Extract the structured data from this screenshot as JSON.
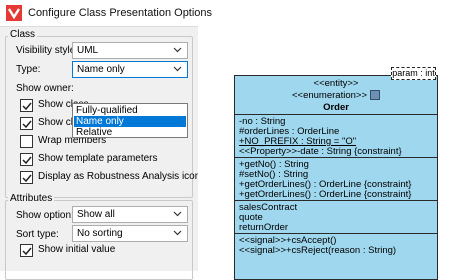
{
  "window": {
    "title": "Configure Class Presentation Options"
  },
  "class_group": {
    "label": "Class",
    "visibility_style": {
      "label": "Visibility style:",
      "value": "UML"
    },
    "type": {
      "label": "Type:",
      "value": "Name only",
      "options": [
        "Fully-qualified",
        "Name only",
        "Relative"
      ],
      "selected_option": "Name only"
    },
    "show_owner": {
      "label": "Show owner:"
    },
    "checkboxes": [
      {
        "label": "Show class",
        "checked": true
      },
      {
        "label": "Show class member constraints",
        "checked": true
      },
      {
        "label": "Wrap members",
        "checked": false
      },
      {
        "label": "Show template parameters",
        "checked": true
      },
      {
        "label": "Display as Robustness Analysis icon",
        "checked": true
      }
    ]
  },
  "attributes_group": {
    "label": "Attributes",
    "show_option": {
      "label": "Show option:",
      "value": "Show all"
    },
    "sort_type": {
      "label": "Sort type:",
      "value": "No sorting"
    },
    "show_initial_value": {
      "label": "Show initial value",
      "checked": true
    }
  },
  "preview": {
    "template_param": "param : int",
    "stereotype_entity": "<<entity>>",
    "stereotype_enumeration": "<<enumeration>>",
    "class_name": "Order",
    "attributes": [
      "-no : String",
      "#orderLines : OrderLine",
      "+NO_PREFIX : String = \"O\"",
      "<<Property>>-date : String {constraint}"
    ],
    "operations": [
      "+getNo() : String",
      "#setNo() : String",
      "+getOrderLines() : OrderLine {constraint}",
      "+getOrderLines() : OrderLine {constraint}"
    ],
    "literals": [
      "salesContract",
      "quote",
      "returnOrder"
    ],
    "receptions": [
      "<<signal>>+csAccept()",
      "<<signal>>+csReject(reason : String)"
    ],
    "colors": {
      "class_fill": "#9fd7ee",
      "accent": "#0078d7"
    }
  }
}
